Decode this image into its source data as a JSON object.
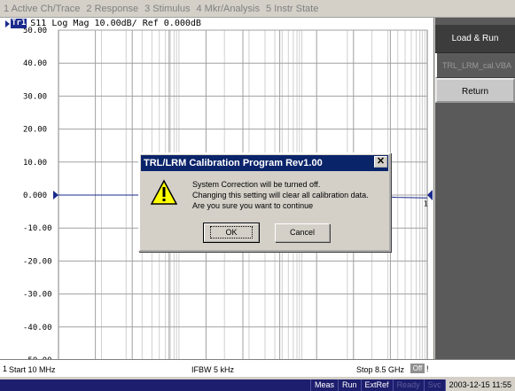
{
  "menu": [
    "1 Active Ch/Trace",
    "2 Response",
    "3 Stimulus",
    "4 Mkr/Analysis",
    "5 Instr State"
  ],
  "trace": {
    "badge": "Tr1",
    "header": "S11 Log Mag 10.00dB/ Ref 0.000dB",
    "color": "#1a2a8c",
    "marker_label": "1"
  },
  "chart_data": {
    "type": "line",
    "yticks": [
      "50.00",
      "40.00",
      "30.00",
      "20.00",
      "10.00",
      "0.000",
      "-10.00",
      "-20.00",
      "-30.00",
      "-40.00",
      "-50.00"
    ],
    "ylim": [
      -50,
      50
    ],
    "reference_value": 0,
    "grid": true,
    "series": [
      {
        "values": [
          0,
          0,
          0,
          0,
          0,
          0,
          0,
          0,
          -0.2,
          -0.4,
          -0.1,
          -0.7,
          -0.9
        ]
      }
    ]
  },
  "status": {
    "channel": "1",
    "start": "Start 10 MHz",
    "ifbw": "IFBW 5 kHz",
    "stop": "Stop 8.5 GHz",
    "corr": "Off",
    "excl": "!"
  },
  "bottom_bar": {
    "meas": "Meas",
    "run": "Run",
    "extref": "ExtRef",
    "ready": "Ready",
    "svc": "Svc",
    "datetime": "2003-12-15 11:55"
  },
  "softkeys": {
    "title": "Load & Run",
    "file": "TRL_LRM_cal.VBA",
    "return_label": "Return"
  },
  "dialog": {
    "title": "TRL/LRM Calibration Program  Rev1.00",
    "close": "✕",
    "icon": "warning-icon",
    "lines": [
      "System Correction will be turned off.",
      "Changing this setting will clear all calibration data.",
      "Are you sure you want to continue"
    ],
    "ok": "OK",
    "cancel": "Cancel"
  }
}
